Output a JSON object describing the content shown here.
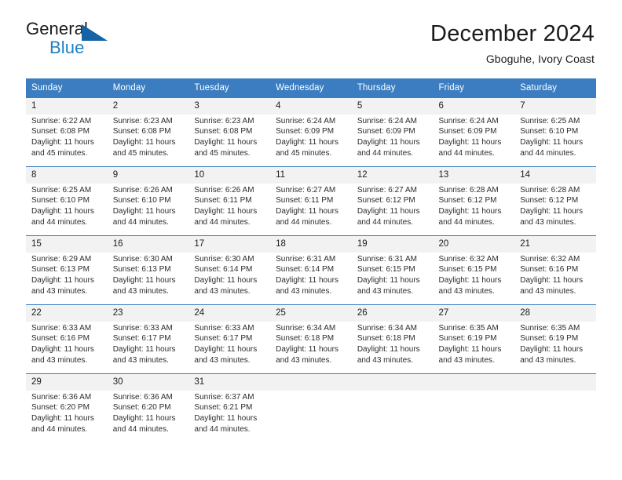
{
  "brand": {
    "name_part1": "General",
    "name_part2": "Blue",
    "logo_icon": "blue-triangle-logo"
  },
  "header": {
    "title": "December 2024",
    "subtitle": "Gboguhe, Ivory Coast"
  },
  "colors": {
    "header_blue": "#3b7dc0",
    "brand_blue": "#1f7fc4",
    "logo_blue": "#1464a5",
    "daynum_bg": "#f2f2f2",
    "text": "#1b1b1b"
  },
  "weekdays": [
    "Sunday",
    "Monday",
    "Tuesday",
    "Wednesday",
    "Thursday",
    "Friday",
    "Saturday"
  ],
  "weeks": [
    [
      {
        "day": "1",
        "sunrise": "Sunrise: 6:22 AM",
        "sunset": "Sunset: 6:08 PM",
        "daylight1": "Daylight: 11 hours",
        "daylight2": "and 45 minutes."
      },
      {
        "day": "2",
        "sunrise": "Sunrise: 6:23 AM",
        "sunset": "Sunset: 6:08 PM",
        "daylight1": "Daylight: 11 hours",
        "daylight2": "and 45 minutes."
      },
      {
        "day": "3",
        "sunrise": "Sunrise: 6:23 AM",
        "sunset": "Sunset: 6:08 PM",
        "daylight1": "Daylight: 11 hours",
        "daylight2": "and 45 minutes."
      },
      {
        "day": "4",
        "sunrise": "Sunrise: 6:24 AM",
        "sunset": "Sunset: 6:09 PM",
        "daylight1": "Daylight: 11 hours",
        "daylight2": "and 45 minutes."
      },
      {
        "day": "5",
        "sunrise": "Sunrise: 6:24 AM",
        "sunset": "Sunset: 6:09 PM",
        "daylight1": "Daylight: 11 hours",
        "daylight2": "and 44 minutes."
      },
      {
        "day": "6",
        "sunrise": "Sunrise: 6:24 AM",
        "sunset": "Sunset: 6:09 PM",
        "daylight1": "Daylight: 11 hours",
        "daylight2": "and 44 minutes."
      },
      {
        "day": "7",
        "sunrise": "Sunrise: 6:25 AM",
        "sunset": "Sunset: 6:10 PM",
        "daylight1": "Daylight: 11 hours",
        "daylight2": "and 44 minutes."
      }
    ],
    [
      {
        "day": "8",
        "sunrise": "Sunrise: 6:25 AM",
        "sunset": "Sunset: 6:10 PM",
        "daylight1": "Daylight: 11 hours",
        "daylight2": "and 44 minutes."
      },
      {
        "day": "9",
        "sunrise": "Sunrise: 6:26 AM",
        "sunset": "Sunset: 6:10 PM",
        "daylight1": "Daylight: 11 hours",
        "daylight2": "and 44 minutes."
      },
      {
        "day": "10",
        "sunrise": "Sunrise: 6:26 AM",
        "sunset": "Sunset: 6:11 PM",
        "daylight1": "Daylight: 11 hours",
        "daylight2": "and 44 minutes."
      },
      {
        "day": "11",
        "sunrise": "Sunrise: 6:27 AM",
        "sunset": "Sunset: 6:11 PM",
        "daylight1": "Daylight: 11 hours",
        "daylight2": "and 44 minutes."
      },
      {
        "day": "12",
        "sunrise": "Sunrise: 6:27 AM",
        "sunset": "Sunset: 6:12 PM",
        "daylight1": "Daylight: 11 hours",
        "daylight2": "and 44 minutes."
      },
      {
        "day": "13",
        "sunrise": "Sunrise: 6:28 AM",
        "sunset": "Sunset: 6:12 PM",
        "daylight1": "Daylight: 11 hours",
        "daylight2": "and 44 minutes."
      },
      {
        "day": "14",
        "sunrise": "Sunrise: 6:28 AM",
        "sunset": "Sunset: 6:12 PM",
        "daylight1": "Daylight: 11 hours",
        "daylight2": "and 43 minutes."
      }
    ],
    [
      {
        "day": "15",
        "sunrise": "Sunrise: 6:29 AM",
        "sunset": "Sunset: 6:13 PM",
        "daylight1": "Daylight: 11 hours",
        "daylight2": "and 43 minutes."
      },
      {
        "day": "16",
        "sunrise": "Sunrise: 6:30 AM",
        "sunset": "Sunset: 6:13 PM",
        "daylight1": "Daylight: 11 hours",
        "daylight2": "and 43 minutes."
      },
      {
        "day": "17",
        "sunrise": "Sunrise: 6:30 AM",
        "sunset": "Sunset: 6:14 PM",
        "daylight1": "Daylight: 11 hours",
        "daylight2": "and 43 minutes."
      },
      {
        "day": "18",
        "sunrise": "Sunrise: 6:31 AM",
        "sunset": "Sunset: 6:14 PM",
        "daylight1": "Daylight: 11 hours",
        "daylight2": "and 43 minutes."
      },
      {
        "day": "19",
        "sunrise": "Sunrise: 6:31 AM",
        "sunset": "Sunset: 6:15 PM",
        "daylight1": "Daylight: 11 hours",
        "daylight2": "and 43 minutes."
      },
      {
        "day": "20",
        "sunrise": "Sunrise: 6:32 AM",
        "sunset": "Sunset: 6:15 PM",
        "daylight1": "Daylight: 11 hours",
        "daylight2": "and 43 minutes."
      },
      {
        "day": "21",
        "sunrise": "Sunrise: 6:32 AM",
        "sunset": "Sunset: 6:16 PM",
        "daylight1": "Daylight: 11 hours",
        "daylight2": "and 43 minutes."
      }
    ],
    [
      {
        "day": "22",
        "sunrise": "Sunrise: 6:33 AM",
        "sunset": "Sunset: 6:16 PM",
        "daylight1": "Daylight: 11 hours",
        "daylight2": "and 43 minutes."
      },
      {
        "day": "23",
        "sunrise": "Sunrise: 6:33 AM",
        "sunset": "Sunset: 6:17 PM",
        "daylight1": "Daylight: 11 hours",
        "daylight2": "and 43 minutes."
      },
      {
        "day": "24",
        "sunrise": "Sunrise: 6:33 AM",
        "sunset": "Sunset: 6:17 PM",
        "daylight1": "Daylight: 11 hours",
        "daylight2": "and 43 minutes."
      },
      {
        "day": "25",
        "sunrise": "Sunrise: 6:34 AM",
        "sunset": "Sunset: 6:18 PM",
        "daylight1": "Daylight: 11 hours",
        "daylight2": "and 43 minutes."
      },
      {
        "day": "26",
        "sunrise": "Sunrise: 6:34 AM",
        "sunset": "Sunset: 6:18 PM",
        "daylight1": "Daylight: 11 hours",
        "daylight2": "and 43 minutes."
      },
      {
        "day": "27",
        "sunrise": "Sunrise: 6:35 AM",
        "sunset": "Sunset: 6:19 PM",
        "daylight1": "Daylight: 11 hours",
        "daylight2": "and 43 minutes."
      },
      {
        "day": "28",
        "sunrise": "Sunrise: 6:35 AM",
        "sunset": "Sunset: 6:19 PM",
        "daylight1": "Daylight: 11 hours",
        "daylight2": "and 43 minutes."
      }
    ],
    [
      {
        "day": "29",
        "sunrise": "Sunrise: 6:36 AM",
        "sunset": "Sunset: 6:20 PM",
        "daylight1": "Daylight: 11 hours",
        "daylight2": "and 44 minutes."
      },
      {
        "day": "30",
        "sunrise": "Sunrise: 6:36 AM",
        "sunset": "Sunset: 6:20 PM",
        "daylight1": "Daylight: 11 hours",
        "daylight2": "and 44 minutes."
      },
      {
        "day": "31",
        "sunrise": "Sunrise: 6:37 AM",
        "sunset": "Sunset: 6:21 PM",
        "daylight1": "Daylight: 11 hours",
        "daylight2": "and 44 minutes."
      },
      {
        "day": "",
        "sunrise": "",
        "sunset": "",
        "daylight1": "",
        "daylight2": ""
      },
      {
        "day": "",
        "sunrise": "",
        "sunset": "",
        "daylight1": "",
        "daylight2": ""
      },
      {
        "day": "",
        "sunrise": "",
        "sunset": "",
        "daylight1": "",
        "daylight2": ""
      },
      {
        "day": "",
        "sunrise": "",
        "sunset": "",
        "daylight1": "",
        "daylight2": ""
      }
    ]
  ]
}
